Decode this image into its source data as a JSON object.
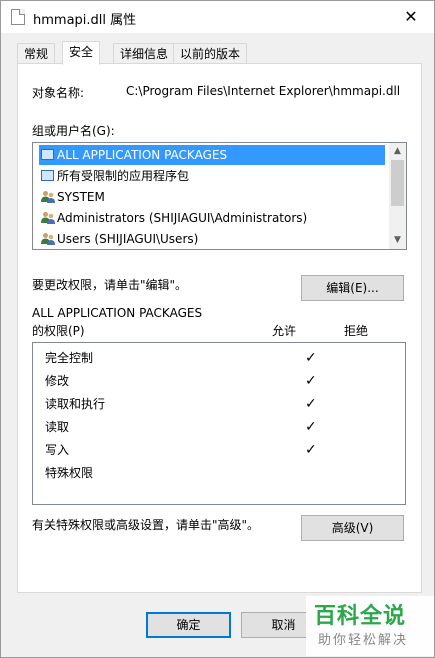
{
  "window": {
    "title": "hmmapi.dll 属性",
    "close_glyph": "✕"
  },
  "tabs": [
    {
      "label": "常规"
    },
    {
      "label": "安全"
    },
    {
      "label": "详细信息"
    },
    {
      "label": "以前的版本"
    }
  ],
  "security": {
    "object_label": "对象名称:",
    "object_value": "C:\\Program Files\\Internet Explorer\\hmmapi.dll",
    "groups_label": "组或用户名(G):",
    "groups": [
      {
        "name": "ALL APPLICATION PACKAGES",
        "icon": "package-icon"
      },
      {
        "name": "所有受限制的应用程序包",
        "icon": "package-icon"
      },
      {
        "name": "SYSTEM",
        "icon": "users-icon"
      },
      {
        "name": "Administrators (SHIJIAGUI\\Administrators)",
        "icon": "users-icon"
      },
      {
        "name": "Users (SHIJIAGUI\\Users)",
        "icon": "users-icon"
      }
    ],
    "change_hint": "要更改权限，请单击\"编辑\"。",
    "edit_label": "编辑(E)...",
    "perm_for": "ALL APPLICATION PACKAGES",
    "perm_label": "的权限(P)",
    "allow_label": "允许",
    "deny_label": "拒绝",
    "permissions": [
      {
        "name": "完全控制",
        "allow": "✓"
      },
      {
        "name": "修改",
        "allow": "✓"
      },
      {
        "name": "读取和执行",
        "allow": "✓"
      },
      {
        "name": "读取",
        "allow": "✓"
      },
      {
        "name": "写入",
        "allow": "✓"
      },
      {
        "name": "特殊权限",
        "allow": ""
      }
    ],
    "advanced_hint": "有关特殊权限或高级设置，请单击\"高级\"。",
    "advanced_label": "高级(V)"
  },
  "footer": {
    "ok_label": "确定",
    "cancel_label": "取消"
  },
  "watermark": {
    "title": "百科全说",
    "subtitle": "助你轻松解决"
  },
  "colors": {
    "selection": "#3399ff",
    "focus_border": "#0078d7",
    "watermark_green": "#2aa84a"
  }
}
